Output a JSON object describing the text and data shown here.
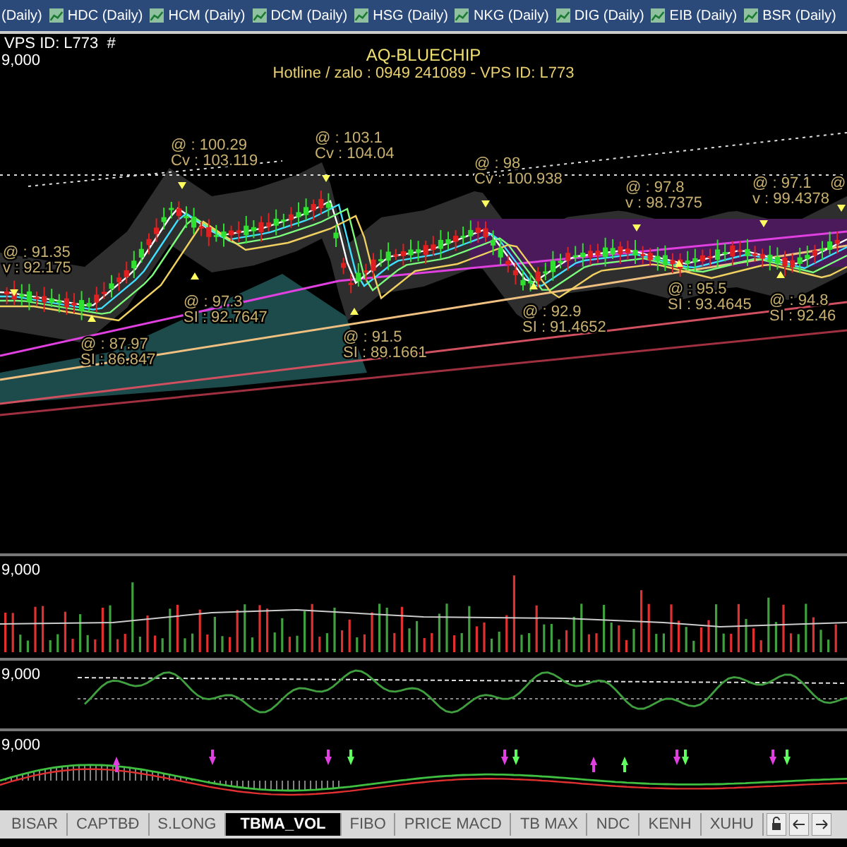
{
  "document_tabs": [
    {
      "label": "(Daily)"
    },
    {
      "label": "HDC (Daily)"
    },
    {
      "label": "HCM (Daily)"
    },
    {
      "label": "DCM (Daily)"
    },
    {
      "label": "HSG (Daily)"
    },
    {
      "label": "NKG (Daily)"
    },
    {
      "label": "DIG (Daily)"
    },
    {
      "label": "EIB (Daily)"
    },
    {
      "label": "BSR (Daily)"
    }
  ],
  "chart": {
    "vps_id": "VPS ID: L773  #",
    "title": "AQ-BLUECHIP",
    "subtitle": "Hotline / zalo : 0949 241089 - VPS ID: L773",
    "price_panel": {
      "axis_label": "9,000",
      "annotations": [
        {
          "kind": "top",
          "lines": [
            "@ : 91.35",
            "v : 92.175"
          ]
        },
        {
          "kind": "bottom",
          "lines": [
            "@ : 87.97",
            "SI : 86.847"
          ]
        },
        {
          "kind": "top",
          "lines": [
            "@ : 100.29",
            "Cv : 103.119"
          ]
        },
        {
          "kind": "bottom",
          "lines": [
            "@ : 97.3",
            "SI : 92.7647"
          ]
        },
        {
          "kind": "top",
          "lines": [
            "@ : 103.1",
            "Cv : 104.04"
          ]
        },
        {
          "kind": "bottom",
          "lines": [
            "@ : 91.5",
            "SI : 89.1661"
          ]
        },
        {
          "kind": "top",
          "lines": [
            "@ : 98",
            "Cv : 100.938"
          ]
        },
        {
          "kind": "bottom",
          "lines": [
            "@ : 92.9",
            "SI : 91.4652"
          ]
        },
        {
          "kind": "top",
          "lines": [
            "@ : 97.8",
            "v : 98.7375"
          ]
        },
        {
          "kind": "bottom",
          "lines": [
            "@ : 95.5",
            "SI : 93.4645"
          ]
        },
        {
          "kind": "top",
          "lines": [
            "@ : 97.1",
            "v : 99.4378"
          ]
        },
        {
          "kind": "top",
          "lines": [
            "@"
          ]
        },
        {
          "kind": "bottom",
          "lines": [
            "@ : 94.8",
            "SI : 92.46"
          ]
        }
      ]
    },
    "volume_panel": {
      "axis_label": "9,000"
    },
    "oscillator_panel": {
      "axis_label": "9,000"
    },
    "signal_panel": {
      "axis_label": "9,000"
    }
  },
  "sheet_tabs": [
    {
      "label": "BISAR",
      "selected": false
    },
    {
      "label": "CAPTBĐ",
      "selected": false
    },
    {
      "label": "S.LONG",
      "selected": false
    },
    {
      "label": "TBMA_VOL",
      "selected": true
    },
    {
      "label": "FIBO",
      "selected": false
    },
    {
      "label": "PRICE MACD",
      "selected": false
    },
    {
      "label": "TB MAX",
      "selected": false
    },
    {
      "label": "NDC",
      "selected": false
    },
    {
      "label": "KENH",
      "selected": false
    },
    {
      "label": "XUHU",
      "selected": false
    }
  ]
}
